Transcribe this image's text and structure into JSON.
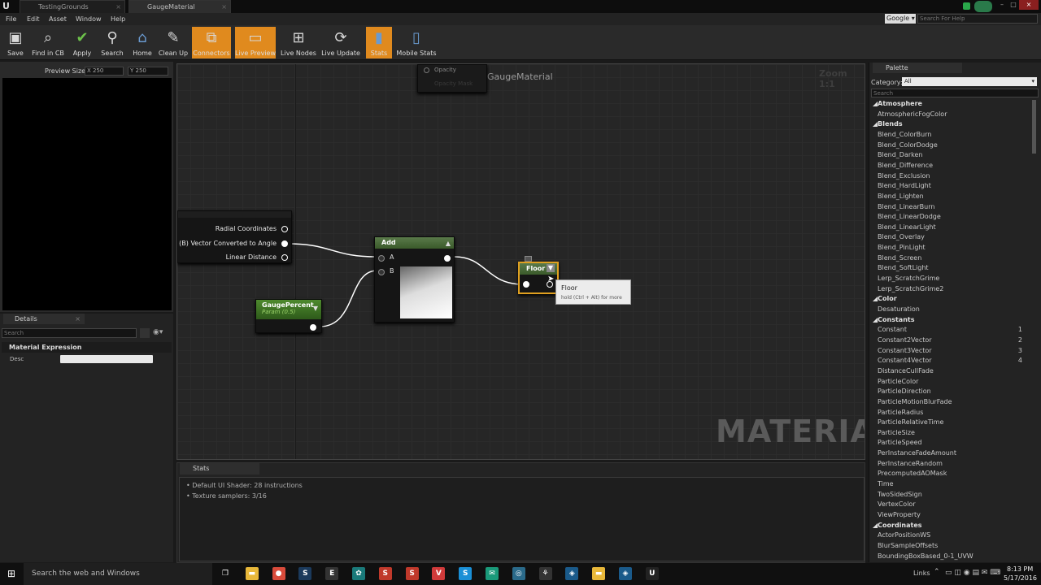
{
  "window": {
    "tabs": [
      "TestingGrounds",
      "GaugeMaterial"
    ],
    "search_engine": "Google",
    "search_placeholder": "Search For Help"
  },
  "menu": [
    "File",
    "Edit",
    "Asset",
    "Window",
    "Help"
  ],
  "toolbar": [
    {
      "label": "Save",
      "icon": "save-icon",
      "active": false
    },
    {
      "label": "Find in CB",
      "icon": "find-in-cb-icon",
      "active": false
    },
    {
      "label": "Apply",
      "icon": "apply-icon",
      "active": false
    },
    {
      "label": "Search",
      "icon": "search-icon",
      "active": false
    },
    {
      "label": "Home",
      "icon": "home-icon",
      "active": false
    },
    {
      "label": "Clean Up",
      "icon": "clean-up-icon",
      "active": false
    },
    {
      "label": "Connectors",
      "icon": "connectors-icon",
      "active": true
    },
    {
      "label": "Live Preview",
      "icon": "live-preview-icon",
      "active": true
    },
    {
      "label": "Live Nodes",
      "icon": "live-nodes-icon",
      "active": false
    },
    {
      "label": "Live Update",
      "icon": "live-update-icon",
      "active": false
    },
    {
      "label": "Stats",
      "icon": "stats-icon",
      "active": true
    },
    {
      "label": "Mobile Stats",
      "icon": "mobile-stats-icon",
      "active": false
    }
  ],
  "preview": {
    "label": "Preview Size",
    "x_value": "X 250",
    "y_value": "Y 250"
  },
  "details": {
    "tab": "Details",
    "search_placeholder": "Search",
    "section": "Material Expression",
    "desc_label": "Desc"
  },
  "graph": {
    "title": "GaugeMaterial",
    "zoom": "Zoom 1:1",
    "watermark": "MATERIAL",
    "result_node": {
      "pin1": "Opacity",
      "pin2": "Opacity Mask"
    },
    "radial_node": {
      "pins": [
        "Radial Coordinates",
        "tput (B) Vector Converted to Angle",
        "Linear Distance"
      ]
    },
    "add_node": {
      "title": "Add",
      "in_a": "A",
      "in_b": "B"
    },
    "param_node": {
      "title": "GaugePercent",
      "subtitle": "Param (0.5)"
    },
    "floor_node": {
      "title": "Floor"
    },
    "tooltip": {
      "title": "Floor",
      "hint": "hold (Ctrl + Alt) for more"
    }
  },
  "stats": {
    "tab": "Stats",
    "lines": [
      "Default UI Shader: 28 instructions",
      "Texture samplers: 3/16"
    ]
  },
  "palette": {
    "tab": "Palette",
    "category_label": "Category:",
    "category_value": "All",
    "search_placeholder": "Search",
    "entries": [
      {
        "cat": "Atmosphere"
      },
      {
        "item": "AtmosphericFogColor"
      },
      {
        "cat": "Blends"
      },
      {
        "item": "Blend_ColorBurn"
      },
      {
        "item": "Blend_ColorDodge"
      },
      {
        "item": "Blend_Darken"
      },
      {
        "item": "Blend_Difference"
      },
      {
        "item": "Blend_Exclusion"
      },
      {
        "item": "Blend_HardLight"
      },
      {
        "item": "Blend_Lighten"
      },
      {
        "item": "Blend_LinearBurn"
      },
      {
        "item": "Blend_LinearDodge"
      },
      {
        "item": "Blend_LinearLight"
      },
      {
        "item": "Blend_Overlay"
      },
      {
        "item": "Blend_PinLight"
      },
      {
        "item": "Blend_Screen"
      },
      {
        "item": "Blend_SoftLight"
      },
      {
        "item": "Lerp_ScratchGrime"
      },
      {
        "item": "Lerp_ScratchGrime2"
      },
      {
        "cat": "Color"
      },
      {
        "item": "Desaturation"
      },
      {
        "cat": "Constants"
      },
      {
        "item": "Constant",
        "num": "1"
      },
      {
        "item": "Constant2Vector",
        "num": "2"
      },
      {
        "item": "Constant3Vector",
        "num": "3"
      },
      {
        "item": "Constant4Vector",
        "num": "4"
      },
      {
        "item": "DistanceCullFade"
      },
      {
        "item": "ParticleColor"
      },
      {
        "item": "ParticleDirection"
      },
      {
        "item": "ParticleMotionBlurFade"
      },
      {
        "item": "ParticleRadius"
      },
      {
        "item": "ParticleRelativeTime"
      },
      {
        "item": "ParticleSize"
      },
      {
        "item": "ParticleSpeed"
      },
      {
        "item": "PerInstanceFadeAmount"
      },
      {
        "item": "PerInstanceRandom"
      },
      {
        "item": "PrecomputedAOMask"
      },
      {
        "item": "Time"
      },
      {
        "item": "TwoSidedSign"
      },
      {
        "item": "VertexColor"
      },
      {
        "item": "ViewProperty"
      },
      {
        "cat": "Coordinates"
      },
      {
        "item": "ActorPositionWS"
      },
      {
        "item": "BlurSampleOffsets"
      },
      {
        "item": "BoundingBoxBased_0-1_UVW"
      }
    ]
  },
  "taskbar": {
    "search_placeholder": "Search the web and Windows",
    "links_label": "Links",
    "time": "8:13 PM",
    "date": "5/17/2016",
    "apps": [
      {
        "name": "task-view-icon",
        "glyph": "❐",
        "color": "#101010"
      },
      {
        "name": "file-explorer-icon",
        "glyph": "▬",
        "color": "#e8b83a"
      },
      {
        "name": "chrome-icon",
        "glyph": "●",
        "color": "#d94b3b"
      },
      {
        "name": "steam-icon",
        "glyph": "S",
        "color": "#1b3a5c"
      },
      {
        "name": "epic-games-icon",
        "glyph": "E",
        "color": "#333333"
      },
      {
        "name": "app-icon",
        "glyph": "✿",
        "color": "#1a7a7a"
      },
      {
        "name": "app-icon",
        "glyph": "S",
        "color": "#c0392b"
      },
      {
        "name": "app-icon",
        "glyph": "S",
        "color": "#c0392b"
      },
      {
        "name": "vivaldi-icon",
        "glyph": "V",
        "color": "#d03a3a"
      },
      {
        "name": "skype-icon",
        "glyph": "S",
        "color": "#1a8fd6"
      },
      {
        "name": "app-icon",
        "glyph": "✉",
        "color": "#1a9a7a"
      },
      {
        "name": "app-icon",
        "glyph": "◎",
        "color": "#2a6a8a"
      },
      {
        "name": "app-icon",
        "glyph": "⚘",
        "color": "#333333"
      },
      {
        "name": "app-icon",
        "glyph": "◈",
        "color": "#1a5a8a"
      },
      {
        "name": "folder-icon",
        "glyph": "▬",
        "color": "#e8b83a"
      },
      {
        "name": "app-icon",
        "glyph": "◈",
        "color": "#1a5a8a"
      },
      {
        "name": "unreal-icon",
        "glyph": "U",
        "color": "#222222"
      }
    ]
  }
}
